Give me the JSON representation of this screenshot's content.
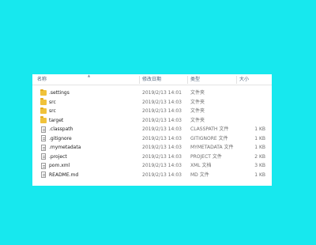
{
  "columns": {
    "name": "名称",
    "date": "修改日期",
    "type": "类型",
    "size": "大小"
  },
  "files": [
    {
      "name": ".settings",
      "date": "2019/2/13 14:01",
      "type": "文件夹",
      "size": "",
      "icon": "folder-icon"
    },
    {
      "name": "src",
      "date": "2019/2/13 14:03",
      "type": "文件夹",
      "size": "",
      "icon": "folder-icon"
    },
    {
      "name": "src",
      "date": "2019/2/13 14:03",
      "type": "文件夹",
      "size": "",
      "icon": "folder-icon"
    },
    {
      "name": "target",
      "date": "2019/2/13 14:03",
      "type": "文件夹",
      "size": "",
      "icon": "folder-icon"
    },
    {
      "name": ".classpath",
      "date": "2019/2/13 14:03",
      "type": "CLASSPATH 文件",
      "size": "1 KB",
      "icon": "file-icon"
    },
    {
      "name": ".gitignore",
      "date": "2019/2/13 14:03",
      "type": "GITIGNORE 文件",
      "size": "1 KB",
      "icon": "file-icon"
    },
    {
      "name": ".mymetadata",
      "date": "2019/2/13 14:03",
      "type": "MYMETADATA 文件",
      "size": "1 KB",
      "icon": "file-icon"
    },
    {
      "name": ".project",
      "date": "2019/2/13 14:03",
      "type": "PROJECT 文件",
      "size": "2 KB",
      "icon": "file-icon"
    },
    {
      "name": "pom.xml",
      "date": "2019/2/13 14:03",
      "type": "XML 文档",
      "size": "3 KB",
      "icon": "file-icon"
    },
    {
      "name": "README.md",
      "date": "2019/2/13 14:03",
      "type": "MD 文件",
      "size": "1 KB",
      "icon": "file-icon"
    }
  ],
  "colors": {
    "desktop": "#17e8ee",
    "window": "#ffffff",
    "folder": "#f0c23a",
    "header_text": "#4c607a"
  }
}
